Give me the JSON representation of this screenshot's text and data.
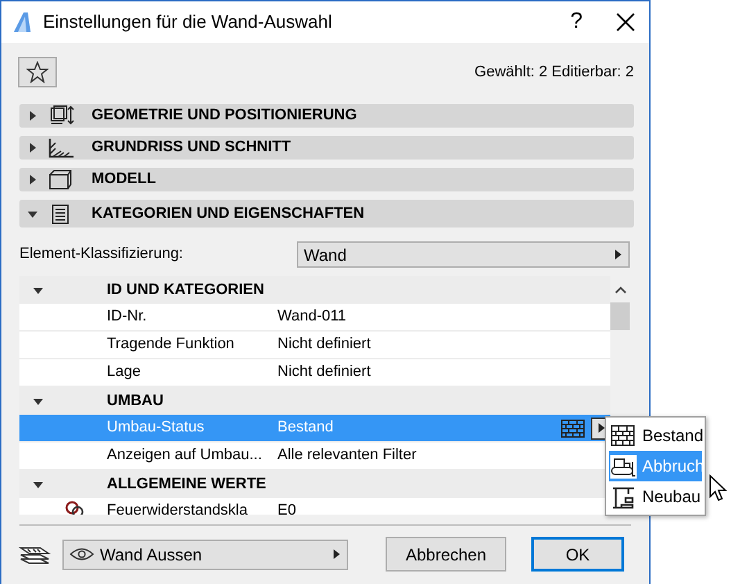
{
  "window": {
    "title": "Einstellungen für die Wand-Auswahl",
    "help": "?"
  },
  "selection_info": "Gewählt: 2 Editierbar: 2",
  "sections": [
    {
      "label": "GEOMETRIE UND POSITIONIERUNG",
      "kind": "geometry",
      "expanded": false
    },
    {
      "label": "GRUNDRISS UND SCHNITT",
      "kind": "plan",
      "expanded": false
    },
    {
      "label": "MODELL",
      "kind": "model",
      "expanded": false
    },
    {
      "label": "KATEGORIEN UND EIGENSCHAFTEN",
      "kind": "document",
      "expanded": true
    }
  ],
  "classification": {
    "label": "Element-Klassifizierung:",
    "value": "Wand"
  },
  "table": {
    "groups": [
      {
        "label": "ID UND KATEGORIEN",
        "expanded": true,
        "rows": [
          {
            "name": "ID-Nr.",
            "value": "Wand-011",
            "selected": false
          },
          {
            "name": "Tragende Funktion",
            "value": "Nicht definiert",
            "selected": false
          },
          {
            "name": "Lage",
            "value": "Nicht definiert",
            "selected": false
          }
        ]
      },
      {
        "label": "UMBAU",
        "expanded": true,
        "rows": [
          {
            "name": "Umbau-Status",
            "value": "Bestand",
            "selected": true,
            "kind": "status"
          },
          {
            "name": "Anzeigen auf Umbau...",
            "value": "Alle relevanten Filter",
            "selected": false
          }
        ]
      },
      {
        "label": "ALLGEMEINE WERTE",
        "expanded": true,
        "rows": [
          {
            "name": "Feuerwiderstandskla",
            "value": "E0",
            "selected": false,
            "kind": "linked"
          }
        ]
      }
    ]
  },
  "status_menu": [
    {
      "label": "Bestand",
      "kind": "existing",
      "selected": false
    },
    {
      "label": "Abbruch",
      "kind": "demolish",
      "selected": true
    },
    {
      "label": "Neubau",
      "kind": "new",
      "selected": false
    }
  ],
  "footer": {
    "layer": "Wand Aussen",
    "buttons": [
      {
        "label": "Abbrechen",
        "default": false
      },
      {
        "label": "OK",
        "default": true
      }
    ]
  }
}
